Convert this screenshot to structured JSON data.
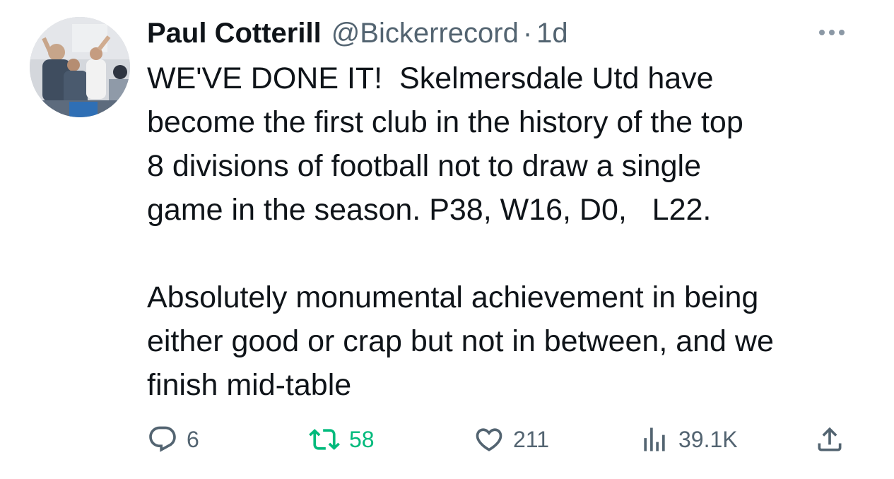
{
  "tweet": {
    "author": {
      "display_name": "Paul Cotterill",
      "handle": "@Bickerrecord",
      "separator": "·",
      "time": "1d"
    },
    "text_lines": [
      "WE'VE DONE IT!  Skelmersdale Utd have",
      "become the first club in the history of the top",
      "8 divisions of football not to draw a single",
      "game in the season. P38, W16, D0,   L22."
    ],
    "text_lines_2": [
      "Absolutely monumental achievement in being",
      "either good or crap but not in between, and we",
      "finish mid-table"
    ],
    "actions": {
      "replies": "6",
      "retweets": "58",
      "likes": "211",
      "views": "39.1K"
    },
    "icons": [
      "more-icon",
      "reply-icon",
      "retweet-icon",
      "like-icon",
      "views-icon",
      "share-icon"
    ],
    "colors": {
      "text": "#0f1419",
      "secondary": "#536471",
      "retweet_active": "#00ba7c"
    }
  }
}
